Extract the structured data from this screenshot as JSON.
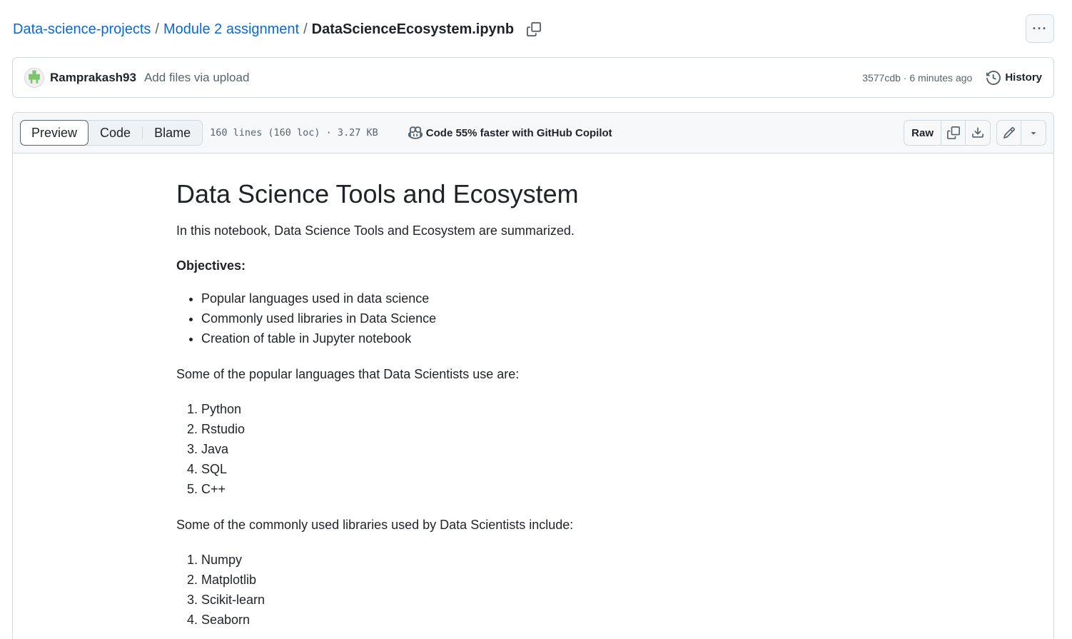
{
  "breadcrumb": {
    "repo": "Data-science-projects",
    "folder": "Module 2 assignment",
    "file": "DataScienceEcosystem.ipynb",
    "separator": "/"
  },
  "more_button": "···",
  "commit": {
    "author": "Ramprakash93",
    "message": "Add files via upload",
    "hash_time": "3577cdb · 6 minutes ago",
    "history_label": "History"
  },
  "file_header": {
    "tabs": [
      "Preview",
      "Code",
      "Blame"
    ],
    "meta": "160 lines (160 loc) · 3.27 KB",
    "copilot_text": "Code 55% faster with GitHub Copilot",
    "raw_label": "Raw"
  },
  "notebook": {
    "title": "Data Science Tools and Ecosystem",
    "intro": "In this notebook, Data Science Tools and Ecosystem are summarized.",
    "objectives_heading": "Objectives:",
    "objectives": [
      "Popular languages used in data science",
      "Commonly used libraries in Data Science",
      "Creation of table in Jupyter notebook"
    ],
    "languages_intro": "Some of the popular languages that Data Scientists use are:",
    "languages": [
      "Python",
      "Rstudio",
      "Java",
      "SQL",
      "C++"
    ],
    "libraries_intro": "Some of the commonly used libraries used by Data Scientists include:",
    "libraries": [
      "Numpy",
      "Matplotlib",
      "Scikit-learn",
      "Seaborn"
    ]
  },
  "colors": {
    "link": "#0969da",
    "text": "#1f2328",
    "muted": "#59636e",
    "border": "#d1d9e0",
    "header_bg": "#f6f8fa"
  }
}
